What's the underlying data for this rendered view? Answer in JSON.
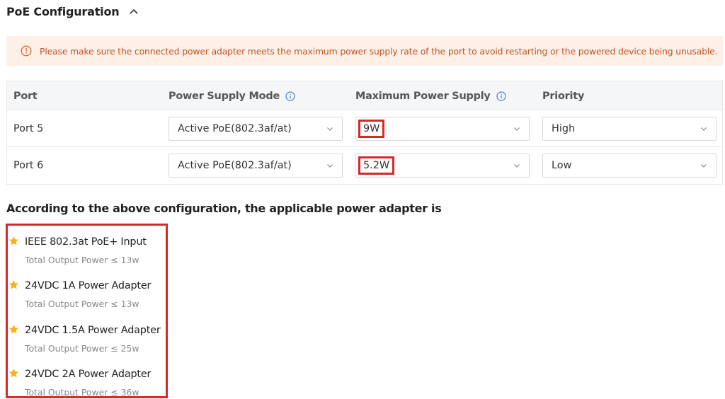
{
  "section": {
    "title": "PoE Configuration"
  },
  "notice": {
    "text": "Please make sure the connected power adapter meets the maximum power supply rate of the port to avoid restarting or the powered device being unusable."
  },
  "table": {
    "headers": {
      "port": "Port",
      "mode": "Power Supply Mode",
      "max_power": "Maximum Power Supply",
      "priority": "Priority"
    },
    "rows": [
      {
        "port": "Port 5",
        "mode": "Active PoE(802.3af/at)",
        "max_power": "9W",
        "priority": "High"
      },
      {
        "port": "Port 6",
        "mode": "Active PoE(802.3af/at)",
        "max_power": "5.2W",
        "priority": "Low"
      }
    ]
  },
  "adapters": {
    "title": "According to the above configuration, the applicable power adapter is",
    "items": [
      {
        "name": "IEEE 802.3at PoE+ Input",
        "power": "Total Output Power ≤ 13w"
      },
      {
        "name": "24VDC 1A Power Adapter",
        "power": "Total Output Power ≤ 13w"
      },
      {
        "name": "24VDC 1.5A Power Adapter",
        "power": "Total Output Power ≤ 25w"
      },
      {
        "name": "24VDC 2A Power Adapter",
        "power": "Total Output Power ≤ 36w"
      }
    ]
  },
  "colors": {
    "accent": "#4a7fd8",
    "warning": "#e06a3a",
    "highlight": "#d6272a",
    "star": "#f5b21b"
  },
  "icons": {
    "collapse": "chevron-up-icon",
    "notice": "warning-circle-icon",
    "info": "info-circle-icon",
    "dropdown": "chevron-down-icon",
    "adapter": "star-icon"
  }
}
